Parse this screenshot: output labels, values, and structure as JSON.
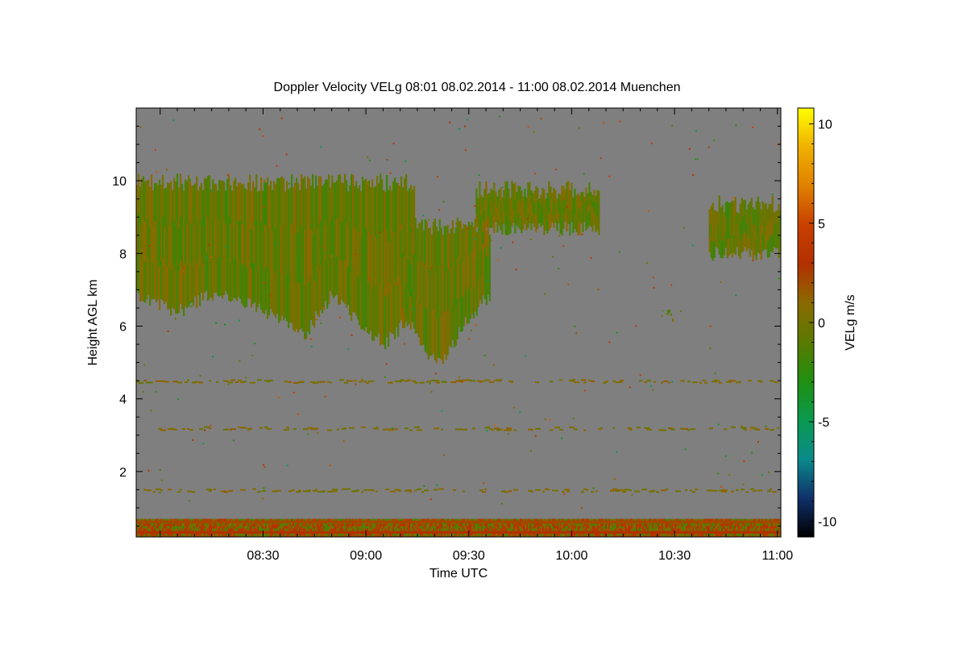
{
  "chart_data": {
    "type": "heatmap",
    "title": "Doppler Velocity VELg   08:01 08.02.2014 - 11:00 08.02.2014 Muenchen",
    "xlabel": "Time UTC",
    "ylabel": "Height AGL km",
    "colorbar_label": "VELg m/s",
    "x_ticks": [
      "08:30",
      "09:00",
      "09:30",
      "10:00",
      "10:30",
      "11:00"
    ],
    "x_tick_minutes": [
      30,
      60,
      90,
      120,
      150,
      180
    ],
    "xlim_minutes": [
      -7,
      181
    ],
    "y_ticks": [
      "2",
      "4",
      "6",
      "8",
      "10"
    ],
    "y_tick_values": [
      2,
      4,
      6,
      8,
      10
    ],
    "ylim": [
      0.2,
      12.0
    ],
    "colorbar_ticks": [
      "10",
      "5",
      "0",
      "-5",
      "-10"
    ],
    "colorbar_values": [
      10,
      5,
      0,
      -5,
      -10
    ],
    "clim": [
      -10.8,
      10.8
    ],
    "colorscale": [
      "#000000",
      "#10306a",
      "#0a8a8a",
      "#0a9a50",
      "#1f8f10",
      "#5a7a00",
      "#8a6a00",
      "#b23000",
      "#c84000",
      "#e08000",
      "#f0b000",
      "#ffff00"
    ],
    "background_color": "#7f7f7f",
    "cloud_regions": [
      {
        "name": "cirrus-upper-left",
        "x_start_minutes": -7,
        "x_end_minutes": 74,
        "top_km": 10.2,
        "bottom_km_profile": [
          [
            -7,
            6.8
          ],
          [
            5,
            6.4
          ],
          [
            15,
            6.9
          ],
          [
            25,
            6.6
          ],
          [
            35,
            6.2
          ],
          [
            42,
            5.8
          ],
          [
            50,
            6.9
          ],
          [
            58,
            6.1
          ],
          [
            65,
            5.5
          ],
          [
            72,
            6.2
          ],
          [
            74,
            6.8
          ]
        ]
      },
      {
        "name": "cirrus-fallstreak",
        "x_start_minutes": 70,
        "x_end_minutes": 96,
        "top_km": 9.0,
        "bottom_km_profile": [
          [
            70,
            6.5
          ],
          [
            78,
            5.2
          ],
          [
            82,
            5.0
          ],
          [
            88,
            6.0
          ],
          [
            96,
            6.9
          ]
        ]
      },
      {
        "name": "cirrus-9.5km",
        "x_start_minutes": 92,
        "x_end_minutes": 128,
        "top_km": 10.0,
        "bottom_km": 8.7
      },
      {
        "name": "cirrus-right",
        "x_start_minutes": 160,
        "x_end_minutes": 181,
        "top_km": 9.6,
        "bottom_km": 8.0
      },
      {
        "name": "small-patch",
        "x_start_minutes": 145,
        "x_end_minutes": 152,
        "top_km": 6.5,
        "bottom_km": 6.3
      }
    ],
    "boundary_layer": {
      "top_km": 0.7,
      "bottom_km": 0.2,
      "dominant_values_ms": [
        0,
        3
      ]
    },
    "weak_layers_km": [
      1.5,
      3.2,
      4.5
    ],
    "grid": false,
    "legend": "colorbar-right"
  }
}
